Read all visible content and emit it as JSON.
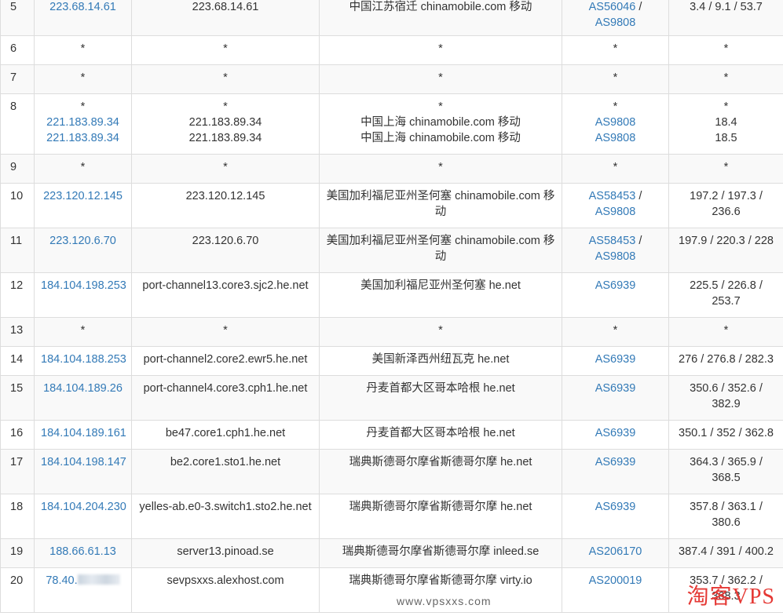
{
  "rows": [
    {
      "hop": "5",
      "ip": [
        "223.68.14.61"
      ],
      "host": [
        "223.68.14.61"
      ],
      "location": [
        "中国江苏宿迁 chinamobile.com 移动"
      ],
      "asn": [
        "AS56046",
        "AS9808"
      ],
      "latency": "3.4 / 9.1 / 53.7"
    },
    {
      "hop": "6",
      "ip": [
        "*"
      ],
      "host": [
        "*"
      ],
      "location": [
        "*"
      ],
      "asn": [
        "*"
      ],
      "latency": "*"
    },
    {
      "hop": "7",
      "ip": [
        "*"
      ],
      "host": [
        "*"
      ],
      "location": [
        "*"
      ],
      "asn": [
        "*"
      ],
      "latency": "*"
    },
    {
      "hop": "8",
      "ip": [
        "*",
        "221.183.89.34",
        "221.183.89.34"
      ],
      "host": [
        "*",
        "221.183.89.34",
        "221.183.89.34"
      ],
      "location": [
        "*",
        "中国上海 chinamobile.com 移动",
        "中国上海 chinamobile.com 移动"
      ],
      "asn": [
        "*",
        "AS9808",
        "AS9808"
      ],
      "latency_lines": [
        "*",
        "18.4",
        "18.5"
      ]
    },
    {
      "hop": "9",
      "ip": [
        "*"
      ],
      "host": [
        "*"
      ],
      "location": [
        "*"
      ],
      "asn": [
        "*"
      ],
      "latency": "*"
    },
    {
      "hop": "10",
      "ip": [
        "223.120.12.145"
      ],
      "host": [
        "223.120.12.145"
      ],
      "location": [
        "美国加利福尼亚州圣何塞 chinamobile.com 移动"
      ],
      "asn": [
        "AS58453",
        "AS9808"
      ],
      "latency": "197.2 / 197.3 / 236.6"
    },
    {
      "hop": "11",
      "ip": [
        "223.120.6.70"
      ],
      "host": [
        "223.120.6.70"
      ],
      "location": [
        "美国加利福尼亚州圣何塞 chinamobile.com 移动"
      ],
      "asn": [
        "AS58453",
        "AS9808"
      ],
      "latency": "197.9 / 220.3 / 228"
    },
    {
      "hop": "12",
      "ip": [
        "184.104.198.253"
      ],
      "host": [
        "port-channel13.core3.sjc2.he.net"
      ],
      "location": [
        "美国加利福尼亚州圣何塞 he.net"
      ],
      "asn": [
        "AS6939"
      ],
      "latency": "225.5 / 226.8 / 253.7"
    },
    {
      "hop": "13",
      "ip": [
        "*"
      ],
      "host": [
        "*"
      ],
      "location": [
        "*"
      ],
      "asn": [
        "*"
      ],
      "latency": "*"
    },
    {
      "hop": "14",
      "ip": [
        "184.104.188.253"
      ],
      "host": [
        "port-channel2.core2.ewr5.he.net"
      ],
      "location": [
        "美国新泽西州纽瓦克 he.net"
      ],
      "asn": [
        "AS6939"
      ],
      "latency": "276 / 276.8 / 282.3"
    },
    {
      "hop": "15",
      "ip": [
        "184.104.189.26"
      ],
      "host": [
        "port-channel4.core3.cph1.he.net"
      ],
      "location": [
        "丹麦首都大区哥本哈根 he.net"
      ],
      "asn": [
        "AS6939"
      ],
      "latency": "350.6 / 352.6 / 382.9"
    },
    {
      "hop": "16",
      "ip": [
        "184.104.189.161"
      ],
      "host": [
        "be47.core1.cph1.he.net"
      ],
      "location": [
        "丹麦首都大区哥本哈根 he.net"
      ],
      "asn": [
        "AS6939"
      ],
      "latency": "350.1 / 352 / 362.8"
    },
    {
      "hop": "17",
      "ip": [
        "184.104.198.147"
      ],
      "host": [
        "be2.core1.sto1.he.net"
      ],
      "location": [
        "瑞典斯德哥尔摩省斯德哥尔摩 he.net"
      ],
      "asn": [
        "AS6939"
      ],
      "latency": "364.3 / 365.9 / 368.5"
    },
    {
      "hop": "18",
      "ip": [
        "184.104.204.230"
      ],
      "host": [
        "yelles-ab.e0-3.switch1.sto2.he.net"
      ],
      "location": [
        "瑞典斯德哥尔摩省斯德哥尔摩 he.net"
      ],
      "asn": [
        "AS6939"
      ],
      "latency": "357.8 / 363.1 / 380.6"
    },
    {
      "hop": "19",
      "ip": [
        "188.66.61.13"
      ],
      "host": [
        "server13.pinoad.se"
      ],
      "location": [
        "瑞典斯德哥尔摩省斯德哥尔摩 inleed.se"
      ],
      "asn": [
        "AS206170"
      ],
      "latency": "387.4 / 391 / 400.2"
    },
    {
      "hop": "20",
      "ip": [
        "78.40."
      ],
      "host": [
        "sevpsxxs.alexhost.com"
      ],
      "location": [
        "瑞典斯德哥尔摩省斯德哥尔摩 virty.io"
      ],
      "asn": [
        "AS200019"
      ],
      "latency": "353.7 / 362.2 / 368.3"
    }
  ],
  "watermark": {
    "text": "淘客VPS",
    "url": "www.vpsxxs.com"
  }
}
